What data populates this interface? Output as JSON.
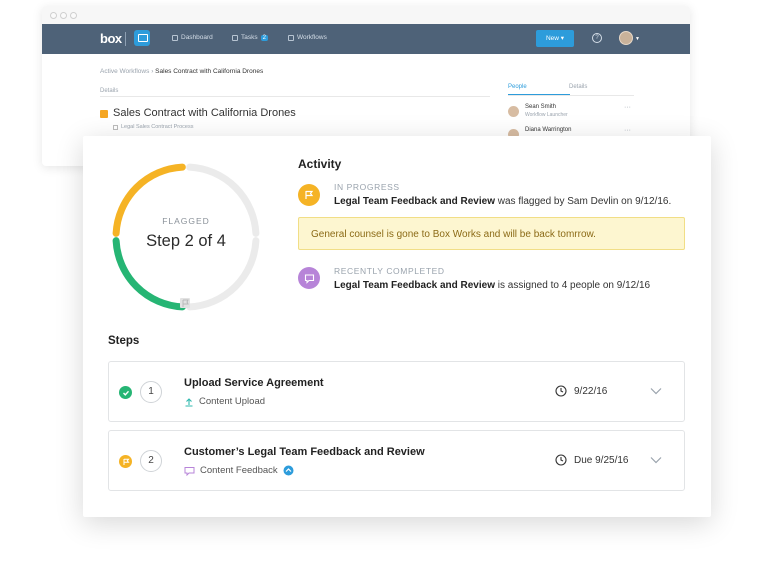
{
  "app": {
    "logo": "box",
    "nav": [
      {
        "label": "Dashboard",
        "icon": "grid-icon"
      },
      {
        "label": "Tasks",
        "badge": "2",
        "icon": "check-square-icon"
      },
      {
        "label": "Workflows",
        "icon": "workflow-icon"
      }
    ],
    "new_button": "New ▾",
    "help": "?"
  },
  "breadcrumb": {
    "parent": "Active Workflows",
    "sep": "›",
    "current": "Sales Contract with California Drones"
  },
  "background": {
    "details_label": "Details",
    "title": "Sales Contract with California Drones",
    "subtitle": "Legal Sales Contract Process",
    "tabs": [
      "People",
      "Details"
    ],
    "people": [
      {
        "name": "Sean Smith",
        "role": "Workflow Launcher"
      },
      {
        "name": "Diana Warrington",
        "role": ""
      }
    ]
  },
  "progress": {
    "label": "FLAGGED",
    "step_text": "Step 2 of 4",
    "completed_segments": 2,
    "total_segments": 4,
    "colors": {
      "done": "#26b574",
      "flagged": "#f5b325",
      "pending": "#ebebeb"
    }
  },
  "activity": {
    "title": "Activity",
    "items": [
      {
        "status": "IN PROGRESS",
        "bold": "Legal Team Feedback and Review",
        "rest": " was flagged by Sam Devlin on 9/12/16.",
        "icon": "flag-icon"
      },
      {
        "status": "RECENTLY COMPLETED",
        "bold": "Legal Team Feedback and Review",
        "rest": " is assigned to 4 people on 9/12/16",
        "icon": "comment-icon"
      }
    ],
    "note": "General counsel is gone to Box Works and will be back tomrrow."
  },
  "steps": {
    "title": "Steps",
    "items": [
      {
        "num": "1",
        "name": "Upload Service Agreement",
        "type": "Content Upload",
        "date": "9/22/16",
        "status": "done"
      },
      {
        "num": "2",
        "name": "Customer’s Legal Team Feedback and Review",
        "type": "Content Feedback",
        "date": "Due 9/25/16",
        "status": "flagged"
      }
    ]
  }
}
